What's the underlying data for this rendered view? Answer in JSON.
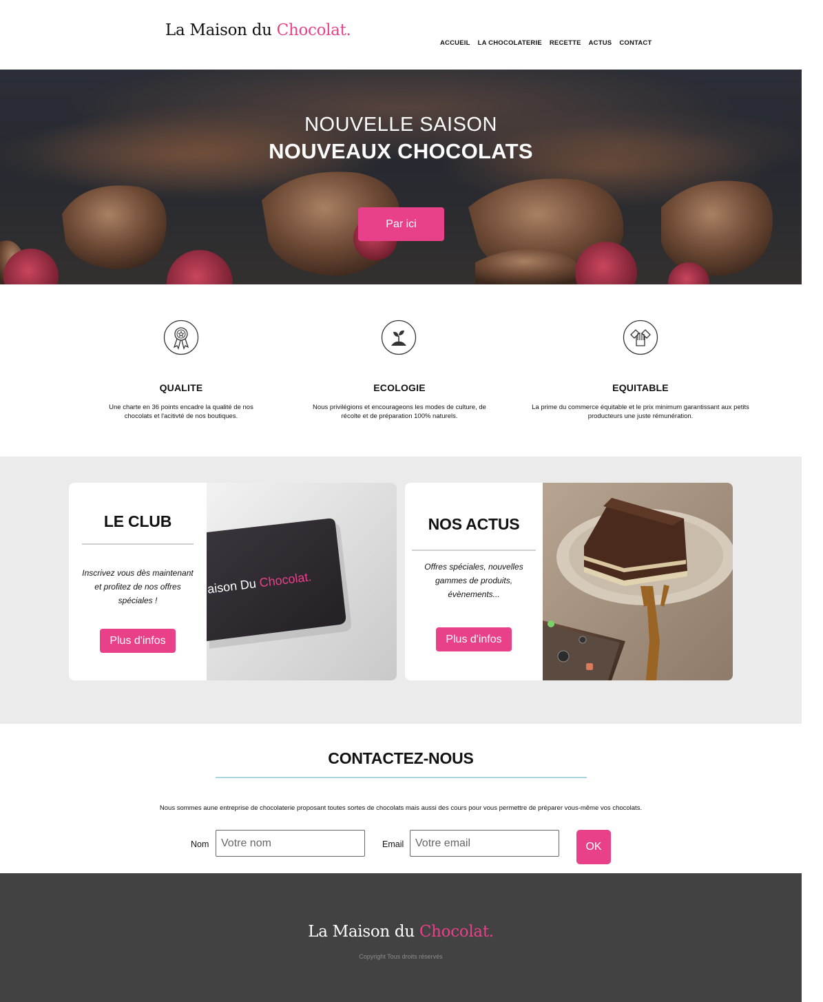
{
  "brand": {
    "name_part1": "La Maison du ",
    "name_part2": "Chocolat."
  },
  "nav": {
    "items": [
      "ACCUEIL",
      "LA CHOCOLATERIE",
      "RECETTE",
      "ACTUS",
      "CONTACT"
    ]
  },
  "hero": {
    "line1": "NOUVELLE SAISON",
    "line2": "NOUVEAUX CHOCOLATS",
    "button": "Par ici"
  },
  "features": [
    {
      "icon": "award-ribbon-icon",
      "title": "QUALITE",
      "text": "Une charte en 36 points encadre la qualité de nos chocolats et l'acitivté de nos boutiques."
    },
    {
      "icon": "seedling-icon",
      "title": "ECOLOGIE",
      "text": "Nous privilégions et encourageons les modes de culture, de récolte et de préparation 100% naturels."
    },
    {
      "icon": "handshake-icon",
      "title": "EQUITABLE",
      "text": "La prime du commerce équitable et le prix minimum garantissant aux petits producteurs une juste rémunération."
    }
  ],
  "cards": {
    "club": {
      "title": "LE CLUB",
      "text": "Inscrivez vous dès maintenant et profitez de nos offres spéciales !",
      "button": "Plus d'infos",
      "card_brand_a": "aison Du ",
      "card_brand_b": "Chocolat."
    },
    "actus": {
      "title": "NOS ACTUS",
      "text": "Offres spéciales, nouvelles gammes de produits, évènements...",
      "button": "Plus d'infos"
    }
  },
  "contact": {
    "title": "CONTACTEZ-NOUS",
    "description": "Nous sommes aune entreprise de chocolaterie proposant toutes sortes de chocolats mais aussi des cours pour vous permettre de préparer vous-même vos chocolats.",
    "name_label": "Nom",
    "name_placeholder": "Votre nom",
    "email_label": "Email",
    "email_placeholder": "Votre email",
    "submit": "OK"
  },
  "footer": {
    "name_part1": "La Maison du ",
    "name_part2": "Chocolat.",
    "copyright": "Copyright Tous droits réservés"
  },
  "colors": {
    "accent": "#e8418a",
    "footer_bg": "#424242",
    "section_bg": "#ebebeb",
    "rule_teal": "#a6d6dc"
  }
}
